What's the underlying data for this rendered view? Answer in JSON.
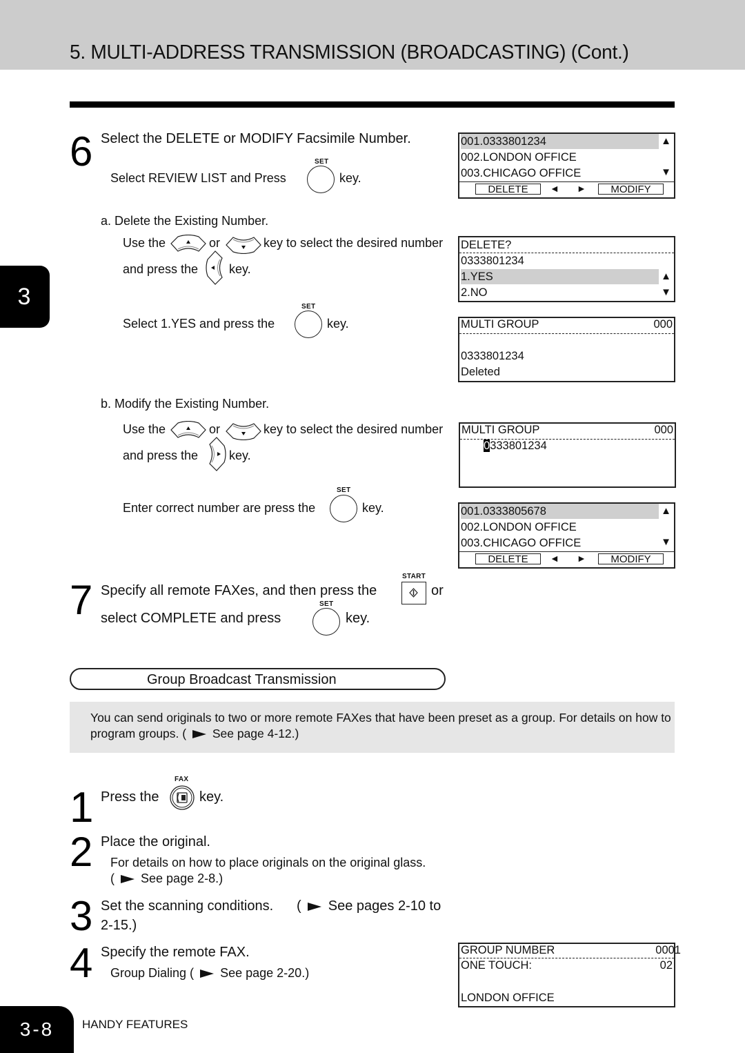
{
  "header": {
    "title": "5. MULTI-ADDRESS TRANSMISSION (BROADCASTING) (Cont.)"
  },
  "chapter_tab": "3",
  "step6": {
    "number": "6",
    "heading": "Select the DELETE or MODIFY Facsimile Number.",
    "line1_pre": "Select  REVIEW LIST  and Press",
    "line1_post": "key.",
    "set_label": "SET",
    "sub_a": {
      "title": "a. Delete the Existing Number.",
      "use_the": "Use the",
      "or": "or",
      "select_desired": "key to select the desired number",
      "and_press": "and press the",
      "key": "key.",
      "select_yes_pre": "Select  1.YES  and press the",
      "select_yes_post": "key."
    },
    "sub_b": {
      "title": "b. Modify the Existing Number.",
      "use_the": "Use the",
      "or": "or",
      "select_desired": "key to select the desired number",
      "and_press": "and press the",
      "key": "key.",
      "enter_pre": "Enter correct number are press the",
      "enter_post": "key."
    }
  },
  "step7": {
    "number": "7",
    "line1": "Specify all remote FAXes, and then press the",
    "or": "or",
    "start_label": "START",
    "line2_pre": "select   COMPLETE   and press",
    "line2_post": "key.",
    "set_label": "SET"
  },
  "lcd": {
    "review1": {
      "rows": [
        "001.0333801234",
        "002.LONDON OFFICE",
        "003.CHICAGO OFFICE"
      ],
      "delete": "DELETE",
      "modify": "MODIFY",
      "left": "◄",
      "right": "►",
      "up": "▲",
      "down": "▼"
    },
    "delete_confirm": {
      "title": "DELETE?",
      "number": "0333801234",
      "yes": "1.YES",
      "no": "2.NO",
      "up": "▲",
      "down": "▼"
    },
    "multi_deleted": {
      "title": "MULTI GROUP",
      "count": "000",
      "number": "0333801234",
      "status": "Deleted"
    },
    "multi_edit": {
      "title": "MULTI GROUP",
      "count": "000",
      "cursor_char": "0",
      "number_rest": "333801234"
    },
    "review2": {
      "rows": [
        "001.0333805678",
        "002.LONDON OFFICE",
        "003.CHICAGO OFFICE"
      ],
      "delete": "DELETE",
      "modify": "MODIFY",
      "left": "◄",
      "right": "►",
      "up": "▲",
      "down": "▼"
    },
    "group": {
      "title": "GROUP NUMBER",
      "group_no": "0001",
      "one_touch": "ONE TOUCH:",
      "one_touch_no": "02",
      "name": "LONDON OFFICE"
    }
  },
  "group_section": {
    "title": "Group Broadcast Transmission",
    "info_pre": "You can send originals to two or more remote FAXes that have been preset as a group. For details on how to program groups. (",
    "info_ref": "See page 4-12.)"
  },
  "steps": [
    {
      "number": "1",
      "pre": "Press the",
      "post": "key.",
      "key_label": "FAX"
    },
    {
      "number": "2",
      "heading": "Place the original.",
      "detail": "For details on how to place originals on the original glass.",
      "ref": "See page 2-8.)"
    },
    {
      "number": "3",
      "heading": "Set the scanning conditions.",
      "ref": "See pages 2-10 to",
      "ref_cont": "2-15.)"
    },
    {
      "number": "4",
      "heading": "Specify the remote FAX.",
      "detail": "Group Dialing (",
      "ref": "See page 2-20.)"
    }
  ],
  "footer": {
    "page": "3-8",
    "section": "HANDY FEATURES"
  }
}
